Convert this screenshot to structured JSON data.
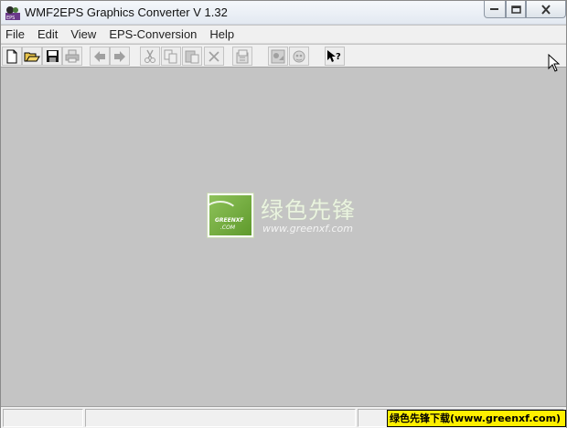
{
  "window": {
    "title": "WMF2EPS Graphics Converter V 1.32"
  },
  "menu": {
    "items": [
      "File",
      "Edit",
      "View",
      "EPS-Conversion",
      "Help"
    ]
  },
  "toolbar": {
    "buttons": [
      {
        "name": "new-icon",
        "enabled": true
      },
      {
        "name": "open-icon",
        "enabled": true
      },
      {
        "name": "save-icon",
        "enabled": true
      },
      {
        "name": "print-icon",
        "enabled": false
      },
      {
        "name": "back-icon",
        "enabled": false
      },
      {
        "name": "forward-icon",
        "enabled": false
      },
      {
        "name": "cut-icon",
        "enabled": false
      },
      {
        "name": "copy-icon",
        "enabled": false
      },
      {
        "name": "paste-icon",
        "enabled": false
      },
      {
        "name": "delete-icon",
        "enabled": false
      },
      {
        "name": "properties-icon",
        "enabled": false
      },
      {
        "name": "convert-icon",
        "enabled": false
      },
      {
        "name": "convert-all-icon",
        "enabled": false
      },
      {
        "name": "context-help-icon",
        "enabled": true
      }
    ]
  },
  "watermark": {
    "logo_line1": "GREENXF",
    "logo_line2": ".COM",
    "site_name_cn": "绿色先锋",
    "url": "www.greenxf.com"
  },
  "statusbar": {
    "banner": "绿色先锋下载(www.greenxf.com)"
  },
  "colors": {
    "workspace": "#c4c4c4",
    "banner_bg": "#ffef00",
    "logo_green": "#7bb342"
  }
}
